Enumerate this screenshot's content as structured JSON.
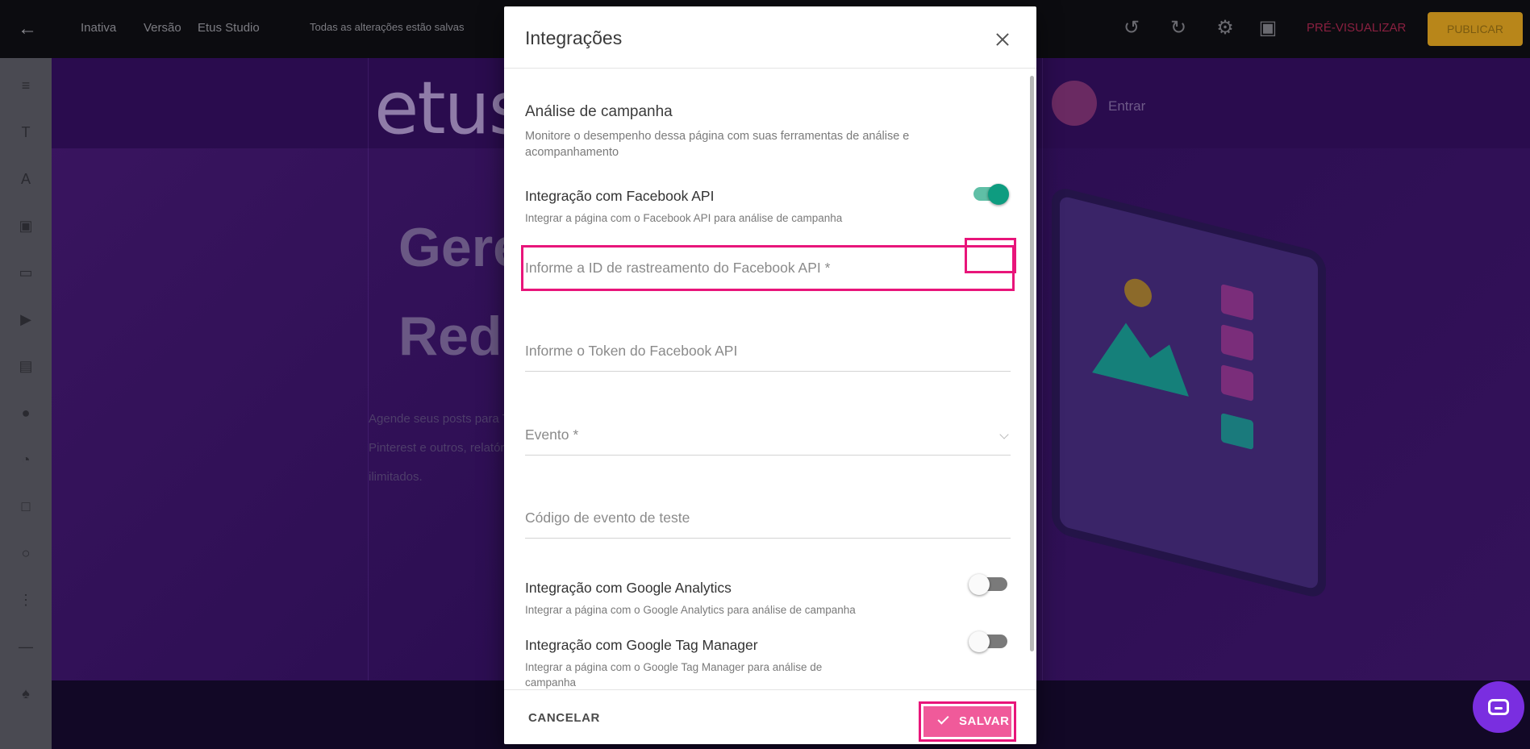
{
  "editor": {
    "topbar": {
      "back_icon": "arrow-left-icon",
      "items": [
        "Inativa",
        "Versão",
        "Etus Studio",
        "Todas as alterações estão salvas"
      ],
      "preview_label": "PRÉ-VISUALIZAR",
      "publish_label": "PUBLICAR"
    },
    "page": {
      "logo_text": "etus",
      "menu_link": "Entrar",
      "hero_title_line1": "Gere",
      "hero_title_line2": "Red",
      "hero_text": "Agende seus posts para Tumblr, Pinterest e outros, relatórios ilimitados."
    }
  },
  "modal": {
    "title": "Integrações",
    "section": {
      "title": "Análise de campanha",
      "description": "Monitore o desempenho dessa página com suas ferramentas de análise e acompanhamento"
    },
    "facebook": {
      "label": "Integração com Facebook API",
      "description": "Integrar a página com o Facebook API para análise de campanha",
      "enabled": true
    },
    "fields": {
      "pixel_id_placeholder": "Informe a ID de rastreamento do Facebook API *",
      "token_placeholder": "Informe o Token do Facebook API",
      "event_placeholder": "Evento *",
      "test_code_placeholder": "Código de evento de teste"
    },
    "google_analytics": {
      "label": "Integração com Google Analytics",
      "description": "Integrar a página com o Google Analytics para análise de campanha",
      "enabled": false
    },
    "google_tag_manager": {
      "label": "Integração com Google Tag Manager",
      "description": "Integrar a página com o Google Tag Manager para análise de campanha",
      "enabled": false
    },
    "footer": {
      "cancel_label": "CANCELAR",
      "save_label": "SALVAR"
    }
  },
  "colors": {
    "accent": "#f05a9a",
    "highlight": "#e8157a",
    "toggle_on": "#0e9c80",
    "chat": "#7a2ee0"
  }
}
